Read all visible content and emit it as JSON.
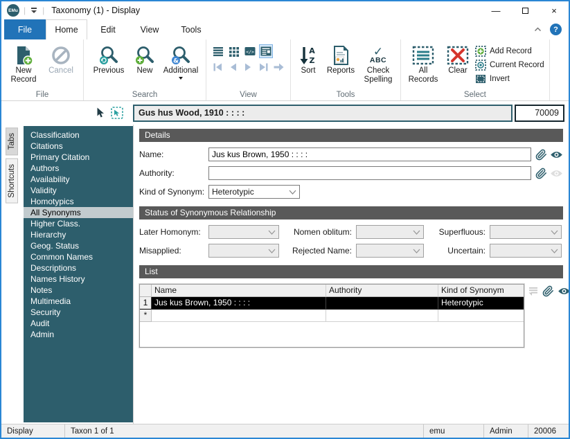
{
  "window": {
    "logo_text": "EMu",
    "title": "Taxonomy (1) - Display"
  },
  "ribbon": {
    "tabs": [
      "File",
      "Home",
      "Edit",
      "View",
      "Tools"
    ],
    "file_group": {
      "label": "File",
      "new_record": "New Record",
      "cancel": "Cancel"
    },
    "search_group": {
      "label": "Search",
      "previous": "Previous",
      "new": "New",
      "additional": "Additional"
    },
    "view_group": {
      "label": "View"
    },
    "tools_group": {
      "label": "Tools",
      "sort": "Sort",
      "reports": "Reports",
      "check_spelling": "Check Spelling",
      "abc_text": "ABC",
      "check_glyph": "✓"
    },
    "select_group": {
      "label": "Select",
      "all_records": "All Records",
      "clear": "Clear",
      "add_record": "Add Record",
      "current_record": "Current Record",
      "invert": "Invert"
    }
  },
  "record_header": {
    "summary": "Gus hus Wood, 1910 : : : :",
    "record_number": "70009"
  },
  "rail": {
    "tabs": "Tabs",
    "shortcuts": "Shortcuts"
  },
  "sidebar": {
    "selected_item": "All Synonyms",
    "items": [
      "Classification",
      "Citations",
      "Primary Citation",
      "Authors",
      "Availability",
      "Validity",
      "Homotypics",
      "All Synonyms",
      "Higher Class.",
      "Hierarchy",
      "Geog. Status",
      "Common Names",
      "Descriptions",
      "Names History",
      "Notes",
      "Multimedia",
      "Security",
      "Audit",
      "Admin"
    ]
  },
  "details": {
    "title": "Details",
    "name_label": "Name:",
    "name_value": "Jus kus Brown, 1950 : : : :",
    "authority_label": "Authority:",
    "authority_value": "",
    "kind_of_synonym_label": "Kind of Synonym:",
    "kind_of_synonym_value": "Heterotypic"
  },
  "status_of_synonymous_relationship": {
    "title": "Status of Synonymous Relationship",
    "fields": [
      {
        "label": "Later Homonym:",
        "value": ""
      },
      {
        "label": "Nomen oblitum:",
        "value": ""
      },
      {
        "label": "Superfluous:",
        "value": ""
      },
      {
        "label": "Misapplied:",
        "value": ""
      },
      {
        "label": "Rejected Name:",
        "value": ""
      },
      {
        "label": "Uncertain:",
        "value": ""
      }
    ]
  },
  "list": {
    "title": "List",
    "columns": [
      "Name",
      "Authority",
      "Kind of Synonym"
    ],
    "rows": [
      {
        "num": "1",
        "name": "Jus kus Brown, 1950 : : : :",
        "authority": "",
        "kind_of_synonym": "Heterotypic",
        "selected": true
      },
      {
        "num": "*",
        "name": "",
        "authority": "",
        "kind_of_synonym": "",
        "selected": false
      }
    ]
  },
  "status_bar": {
    "mode": "Display",
    "record_position": "Taxon 1 of 1",
    "user": "emu",
    "role": "Admin",
    "number": "20006"
  },
  "colors": {
    "accent_blue": "#2173b8",
    "window_border_blue": "#2a86d4",
    "brand_teal": "#2d5e6c",
    "section_header_gray": "#595959",
    "selected_row_black": "#000000",
    "new_green": "#5fae3c",
    "clear_red": "#d5352c",
    "sidebar_selected": "#c2cbce"
  }
}
